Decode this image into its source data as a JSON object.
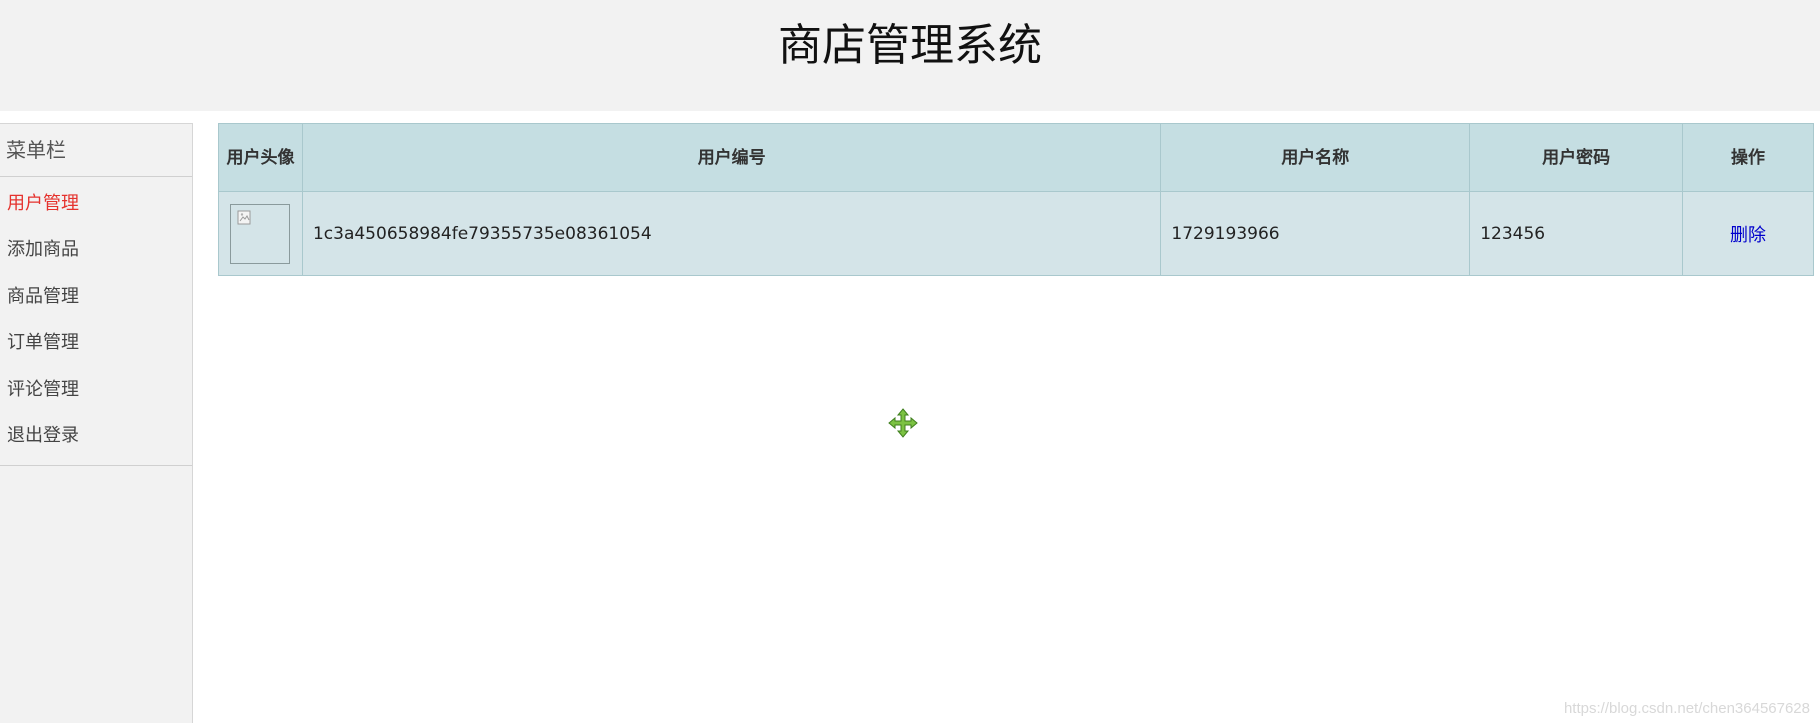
{
  "header": {
    "title": "商店管理系统"
  },
  "sidebar": {
    "title": "菜单栏",
    "items": [
      {
        "label": "用户管理",
        "active": true
      },
      {
        "label": "添加商品"
      },
      {
        "label": "商品管理"
      },
      {
        "label": "订单管理"
      },
      {
        "label": "评论管理"
      },
      {
        "label": "退出登录"
      }
    ]
  },
  "table": {
    "headers": {
      "avatar": "用户头像",
      "id": "用户编号",
      "name": "用户名称",
      "password": "用户密码",
      "action": "操作"
    },
    "rows": [
      {
        "avatar_icon": "broken-image-icon",
        "id": "1c3a450658984fe79355735e08361054",
        "name": "1729193966",
        "password": "123456",
        "action_label": "删除"
      }
    ]
  },
  "cursor": {
    "icon": "move-cursor-icon"
  },
  "watermark": "https://blog.csdn.net/chen364567628",
  "colors": {
    "header_bg": "#f2f2f2",
    "table_header_bg": "#c5dee2",
    "table_row_bg": "#d4e4e8",
    "active_menu": "#e5322d",
    "link": "#0000cc"
  }
}
